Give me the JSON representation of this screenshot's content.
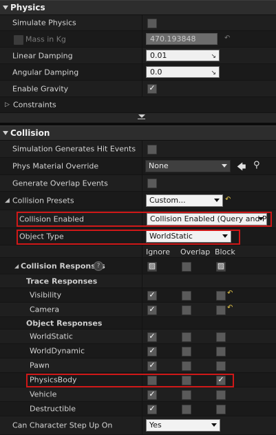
{
  "physics": {
    "title": "Physics",
    "simulate_physics": "Simulate Physics",
    "mass_label": "Mass in Kg",
    "mass_value": "470.193848",
    "linear_damping": "Linear Damping",
    "linear_damping_value": "0.01",
    "angular_damping": "Angular Damping",
    "angular_damping_value": "0.0",
    "enable_gravity": "Enable Gravity",
    "constraints": "Constraints"
  },
  "collision": {
    "title": "Collision",
    "sim_hit_events": "Simulation Generates Hit Events",
    "phys_material_override": "Phys Material Override",
    "phys_material_value": "None",
    "generate_overlap": "Generate Overlap Events",
    "collision_presets": "Collision Presets",
    "collision_presets_value": "Custom...",
    "collision_enabled": "Collision Enabled",
    "collision_enabled_value": "Collision Enabled (Query and Pl",
    "object_type": "Object Type",
    "object_type_value": "WorldStatic",
    "col_ignore": "Ignore",
    "col_overlap": "Overlap",
    "col_block": "Block",
    "collision_responses": "Collision Responses",
    "help": "?",
    "trace_responses": "Trace Responses",
    "visibility": "Visibility",
    "camera": "Camera",
    "object_responses": "Object Responses",
    "world_static": "WorldStatic",
    "world_dynamic": "WorldDynamic",
    "pawn": "Pawn",
    "physics_body": "PhysicsBody",
    "vehicle": "Vehicle",
    "destructible": "Destructible",
    "can_step_up": "Can Character Step Up On",
    "can_step_up_value": "Yes"
  },
  "colors": {
    "highlight_border": "#d01818",
    "reset_arrow": "#e8c84a"
  }
}
